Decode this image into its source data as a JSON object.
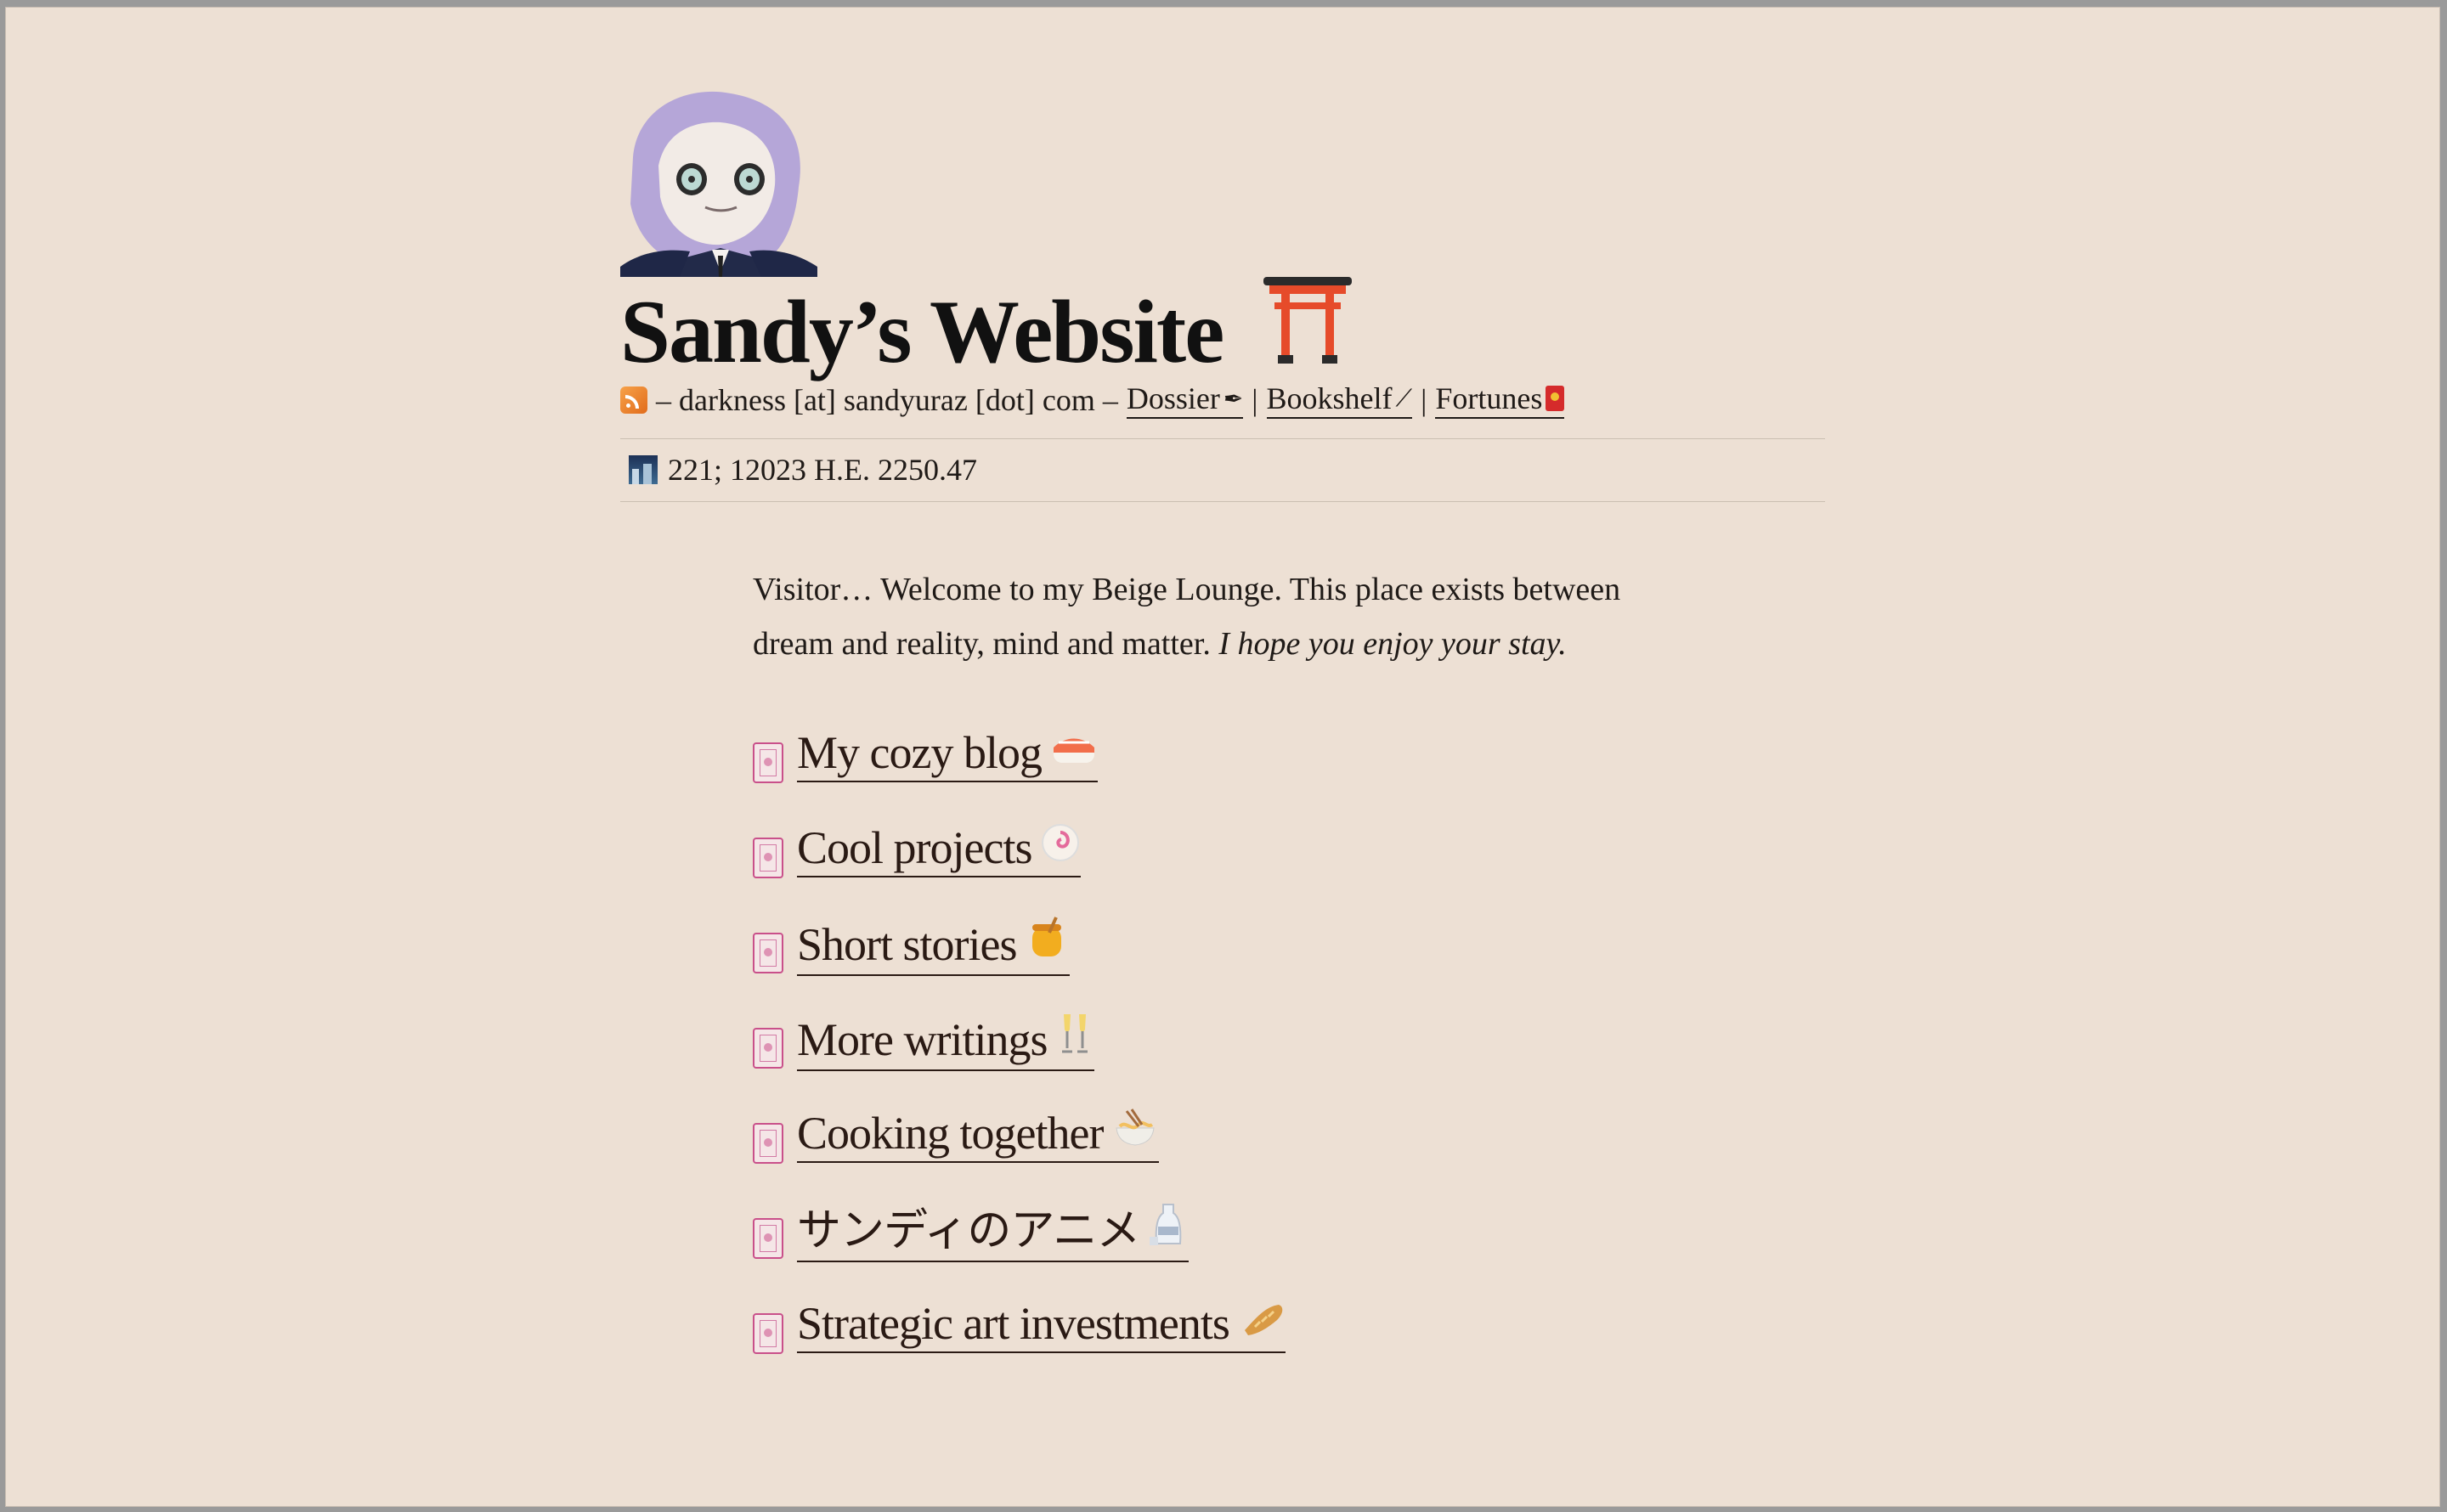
{
  "site": {
    "title": "Sandy’s Website",
    "contact": "– darkness [at] sandyuraz [dot] com –",
    "date": "221; 12023 H.E. 2250.47"
  },
  "nav": [
    {
      "label": "Dossier",
      "icon": "pen-icon"
    },
    {
      "label": "Bookshelf",
      "icon": "wand-icon"
    },
    {
      "label": "Fortunes",
      "icon": "envelope-icon"
    }
  ],
  "intro": {
    "text": "Visitor… Welcome to my Beige Lounge. This place exists between dream and reality, mind and matter.",
    "italic": "I hope you enjoy your stay."
  },
  "menu": [
    {
      "label": "My cozy blog",
      "icon": "sushi-icon"
    },
    {
      "label": "Cool projects",
      "icon": "fishcake-icon"
    },
    {
      "label": "Short stories",
      "icon": "honey-icon"
    },
    {
      "label": "More writings",
      "icon": "champagne-icon"
    },
    {
      "label": "Cooking together",
      "icon": "noodles-icon"
    },
    {
      "label": "サンディのアニメ",
      "icon": "sake-icon"
    },
    {
      "label": "Strategic art investments",
      "icon": "bread-icon"
    }
  ],
  "colors": {
    "background": "#ede0d4",
    "text": "#1f1a17",
    "accent": "#c9508a"
  }
}
